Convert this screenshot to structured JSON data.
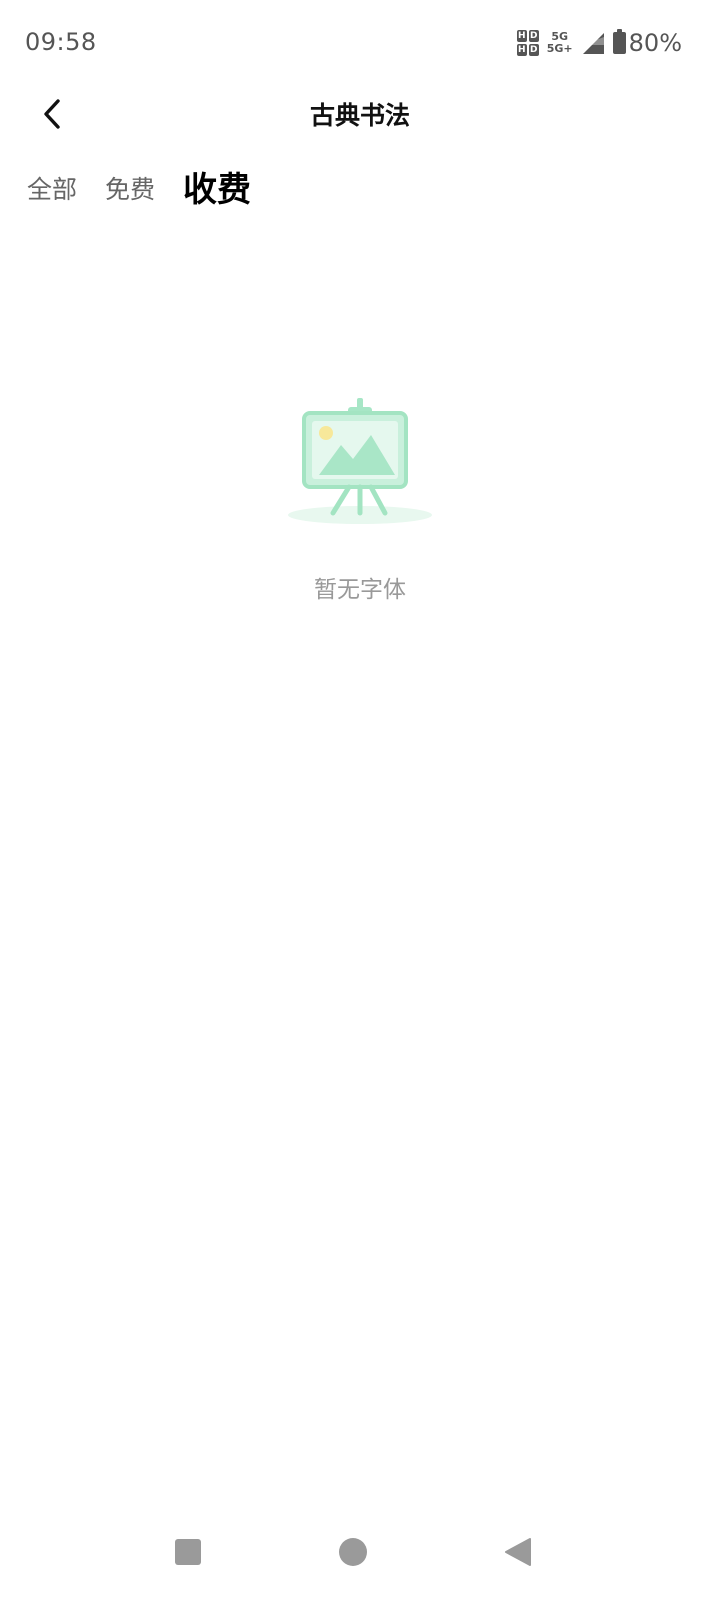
{
  "status_bar": {
    "time": "09:58",
    "hd_icon": "hd-icon",
    "network_top": "5G",
    "network_bottom": "5G+",
    "signal_icon": "signal-icon",
    "battery_icon": "battery-icon",
    "battery_percent": "80%"
  },
  "header": {
    "back_icon": "chevron-left-icon",
    "title": "古典书法"
  },
  "tabs": [
    {
      "label": "全部",
      "active": false
    },
    {
      "label": "免费",
      "active": false
    },
    {
      "label": "收费",
      "active": true
    }
  ],
  "empty_state": {
    "illustration": "easel-picture-icon",
    "text": "暂无字体"
  },
  "nav_bar": {
    "recent_icon": "square-icon",
    "home_icon": "circle-icon",
    "back_icon": "triangle-back-icon"
  },
  "colors": {
    "accent_green": "#9ee3bf",
    "accent_yellow": "#f7e89a",
    "text_muted": "#999999"
  }
}
